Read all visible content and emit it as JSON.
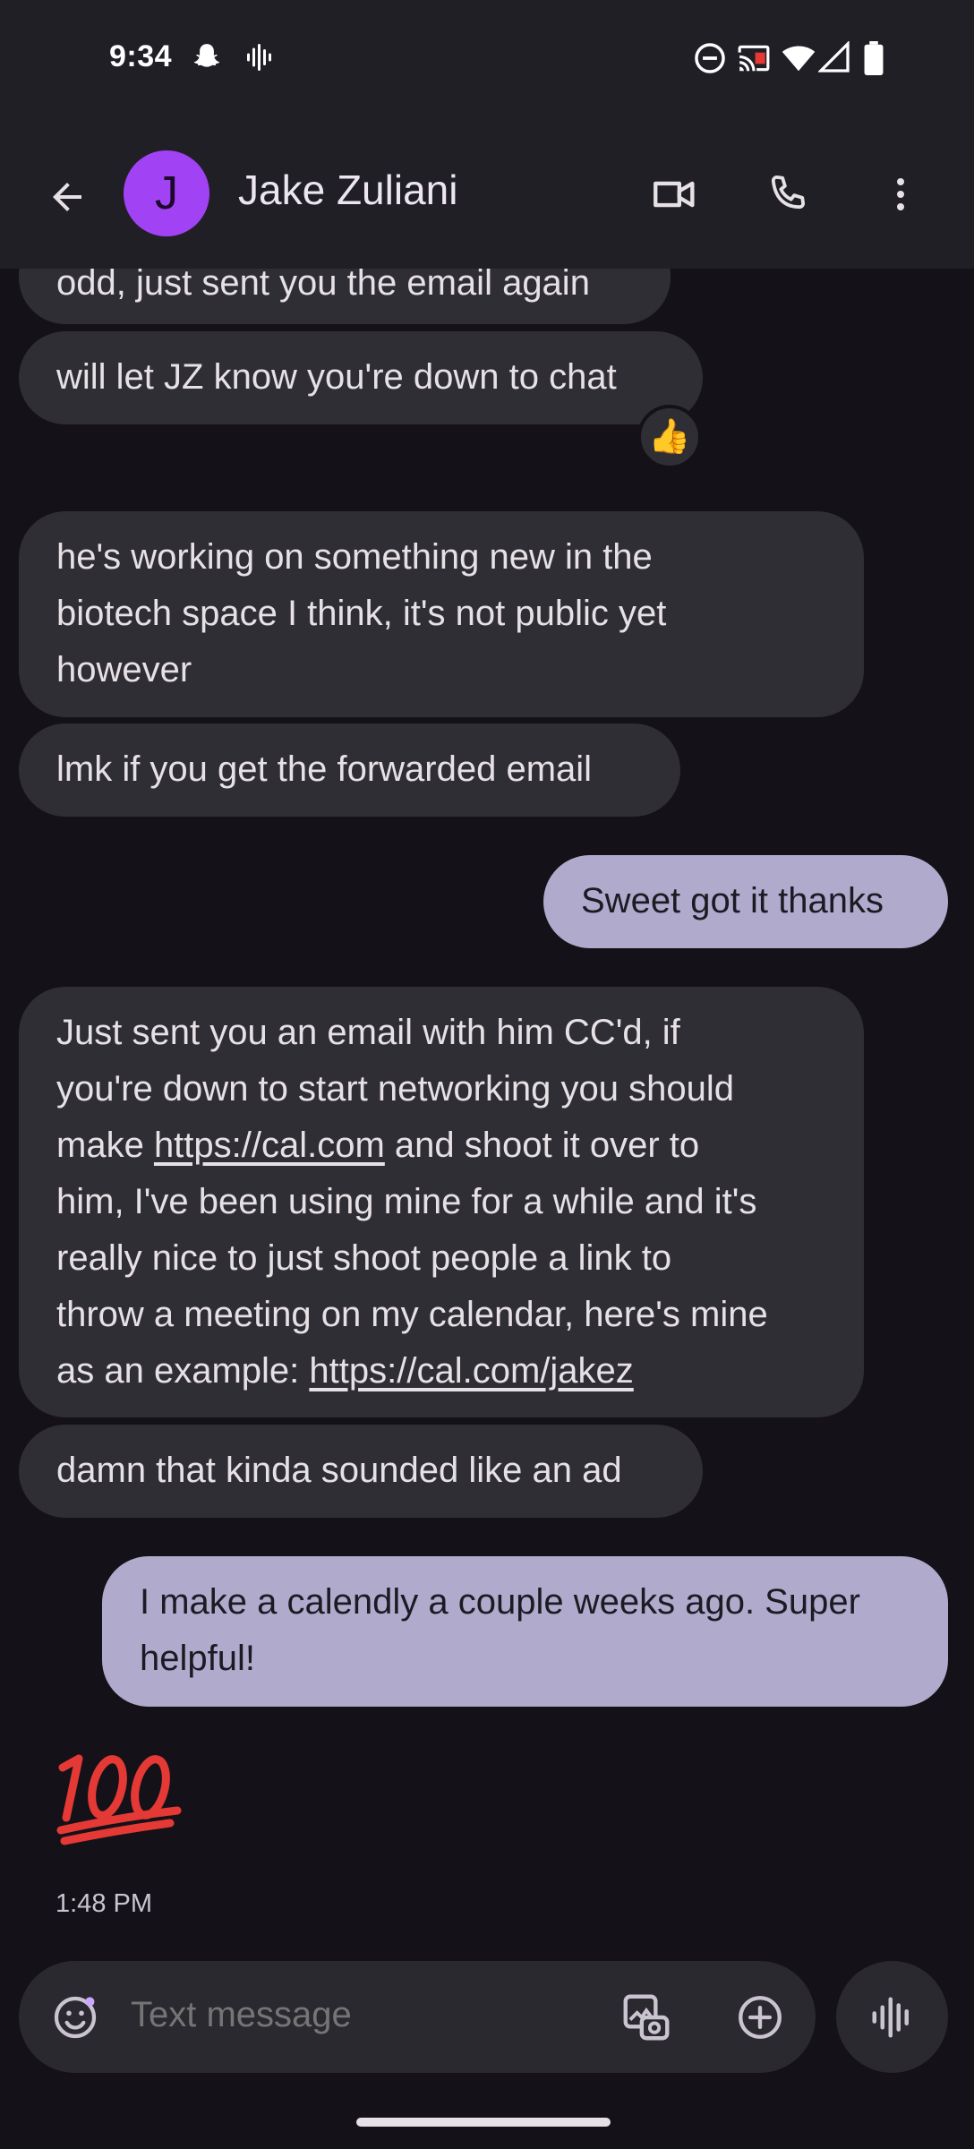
{
  "status_bar": {
    "time": "9:34"
  },
  "header": {
    "avatar_initial": "J",
    "contact_name": "Jake Zuliani"
  },
  "messages": {
    "m1": "odd, just sent you the email again",
    "m2": "will let JZ know you're down to chat",
    "m2_reaction": "👍",
    "m3_line1": "he's working on something new in the",
    "m3_line2": "biotech space I think, it's not public yet",
    "m3_line3": "however",
    "m4": "lmk if you get the forwarded email",
    "m5": "Sweet got it thanks",
    "m6_line1": "Just sent you an email with him CC'd, if",
    "m6_line2": "you're down to start networking you should",
    "m6_line3_pre": "make ",
    "m6_link1": "https://cal.com",
    "m6_line3_post": " and shoot it over to",
    "m6_line4": "him, I've been using mine for a while and it's",
    "m6_line5": "really nice to just shoot people a link to",
    "m6_line6": "throw a meeting on my calendar, here's mine",
    "m6_line7_pre": "as an example: ",
    "m6_link2": "https://cal.com/jakez",
    "m7": "damn that kinda sounded like an ad",
    "m8_line1": "I make a calendly a couple weeks ago. Super",
    "m8_line2": "helpful!",
    "m9_emoji": "100",
    "m9_time": "1:48 PM"
  },
  "composer": {
    "placeholder": "Text message"
  },
  "colors": {
    "background": "#141218",
    "bar": "#211f26",
    "incoming_bubble": "#302e35",
    "outgoing_bubble": "#b0abcc",
    "avatar": "#a142f4",
    "hundred_red": "#e53935"
  }
}
